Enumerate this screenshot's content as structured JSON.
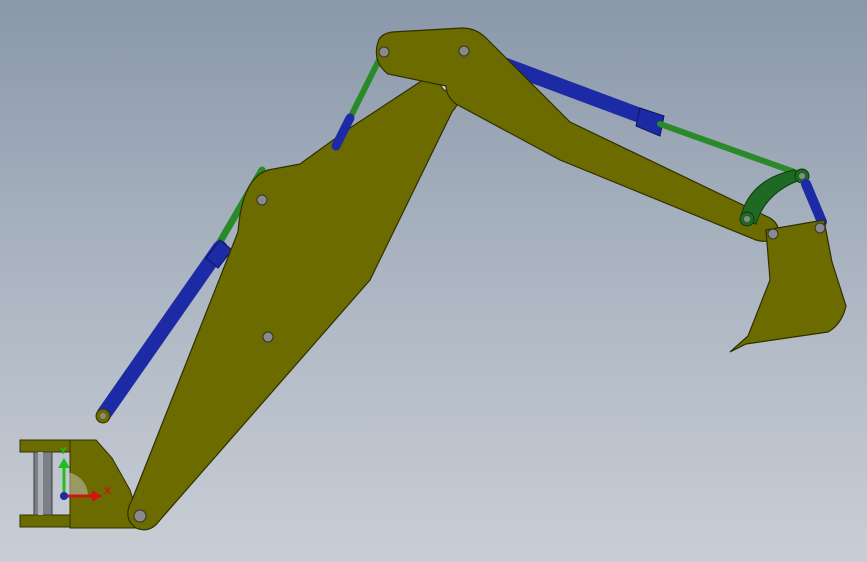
{
  "viewport": {
    "background_top": "#8a98aa",
    "background_bottom": "#c9ced6"
  },
  "model": {
    "body_color": "#6b6b00",
    "body_edge": "#2f3000",
    "cylinder_color": "#1c2aa6",
    "rod_color": "#2a8a2a",
    "link_color": "#1f6a22",
    "pin_color": "#8a8a8a"
  },
  "triad": {
    "y_label": "Y",
    "x_label": "X",
    "y_color": "#1fbf1f",
    "x_color": "#d01414"
  }
}
